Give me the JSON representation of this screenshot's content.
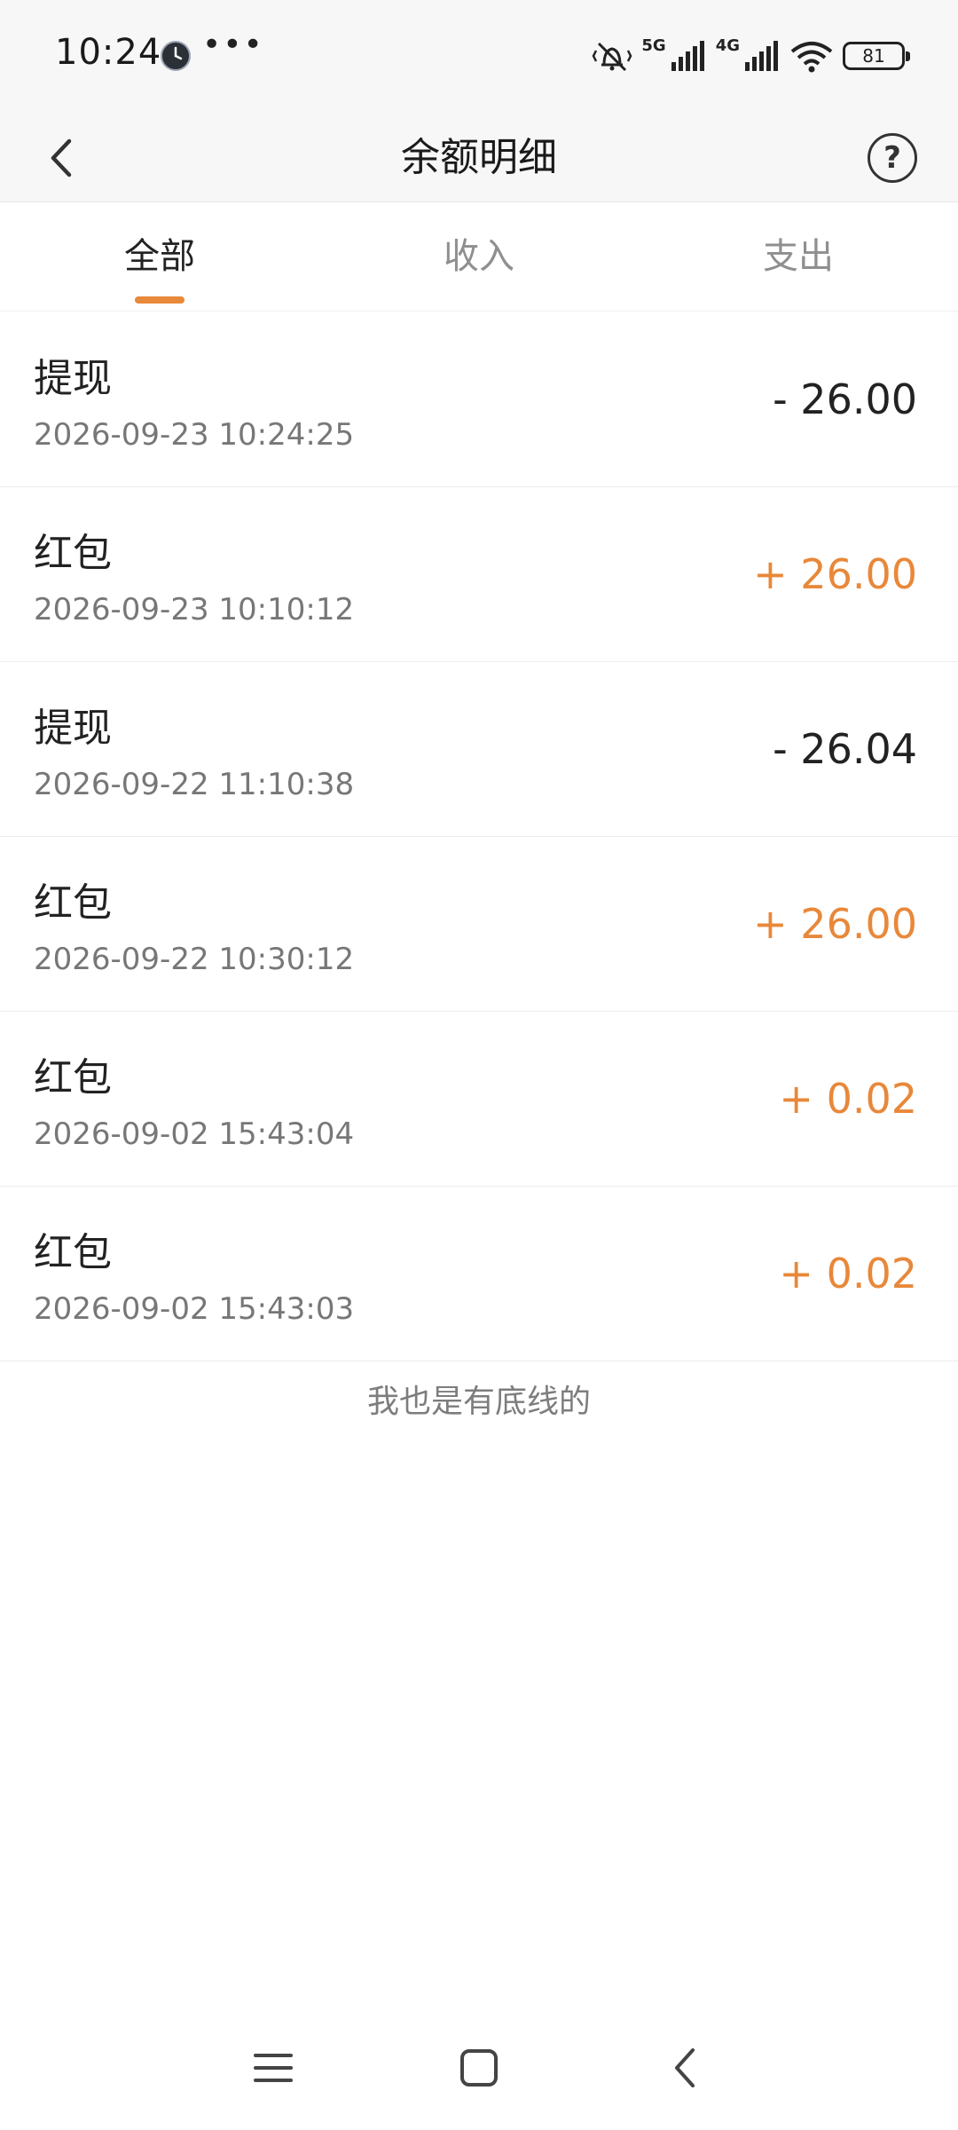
{
  "status_bar": {
    "time": "10:24",
    "more": "•••",
    "network_1": "5G",
    "network_2": "4G",
    "battery": "81"
  },
  "header": {
    "title": "余额明细"
  },
  "tabs": [
    {
      "label": "全部",
      "active": true
    },
    {
      "label": "收入",
      "active": false
    },
    {
      "label": "支出",
      "active": false
    }
  ],
  "transactions": [
    {
      "name": "提现",
      "time": "2026-09-23 10:24:25",
      "amount": "- 26.00",
      "type": "expense"
    },
    {
      "name": "红包",
      "time": "2026-09-23 10:10:12",
      "amount": "+ 26.00",
      "type": "income"
    },
    {
      "name": "提现",
      "time": "2026-09-22 11:10:38",
      "amount": "- 26.04",
      "type": "expense"
    },
    {
      "name": "红包",
      "time": "2026-09-22 10:30:12",
      "amount": "+ 26.00",
      "type": "income"
    },
    {
      "name": "红包",
      "time": "2026-09-02 15:43:04",
      "amount": "+ 0.02",
      "type": "income"
    },
    {
      "name": "红包",
      "time": "2026-09-02 15:43:03",
      "amount": "+ 0.02",
      "type": "income"
    }
  ],
  "footer_note": "我也是有底线的",
  "colors": {
    "accent": "#e8883a",
    "text_primary": "#222222",
    "text_secondary": "#777777"
  },
  "icons": {
    "back": "chevron-left-icon",
    "help": "question-circle-icon",
    "nav_menu": "menu-lines-icon",
    "nav_home": "square-icon",
    "nav_back": "chevron-left-icon"
  }
}
